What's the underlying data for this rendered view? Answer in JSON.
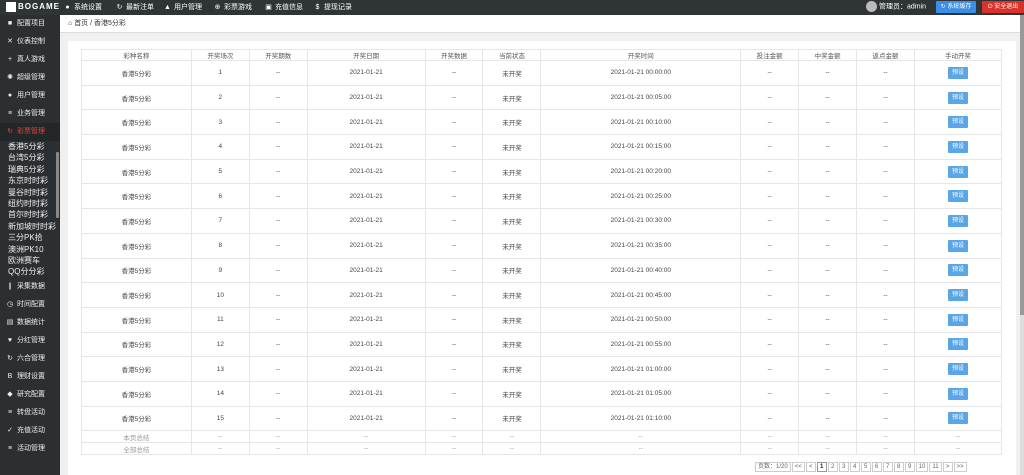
{
  "topbar": {
    "logo": "BOGAME",
    "menu": [
      {
        "label": "系统设置",
        "icon": "gear-icon",
        "glyph": "●"
      },
      {
        "label": "最新注单",
        "icon": "refresh-icon",
        "glyph": "↻"
      },
      {
        "label": "用户管理",
        "icon": "user-icon",
        "glyph": "▲"
      },
      {
        "label": "彩票游戏",
        "icon": "lottery-icon",
        "glyph": "⊕"
      },
      {
        "label": "充值信息",
        "icon": "card-icon",
        "glyph": "▣"
      },
      {
        "label": "提现记录",
        "icon": "dollar-icon",
        "glyph": "$"
      }
    ],
    "admin_label": "管理员：admin",
    "sysreg_label": "系统缓存",
    "logout_label": "安全退出"
  },
  "sidebar": {
    "items_top": [
      {
        "label": "配置项目",
        "icon": "config-icon",
        "glyph": "■"
      },
      {
        "label": "仪表控制",
        "icon": "shuffle-icon",
        "glyph": "✕"
      },
      {
        "label": "真人游戏",
        "icon": "plus-icon",
        "glyph": "+"
      },
      {
        "label": "超级管理",
        "icon": "gear-icon",
        "glyph": "✺"
      },
      {
        "label": "用户管理",
        "icon": "user-icon",
        "glyph": "●"
      },
      {
        "label": "业务管理",
        "icon": "list-icon",
        "glyph": "≡"
      },
      {
        "label": "彩票管理",
        "icon": "refresh-icon",
        "glyph": "↻"
      }
    ],
    "sub_items": [
      "香港5分彩",
      "台湾5分彩",
      "瑞典5分彩",
      "东京时时彩",
      "曼谷时时彩",
      "纽约时时彩",
      "首尔时时彩",
      "新加坡时时彩",
      "三分PK拾",
      "澳洲PK10",
      "欧洲赛车",
      "QQ分分彩"
    ],
    "items_bottom": [
      {
        "label": "采集数据",
        "icon": "bars-icon",
        "glyph": "∥"
      },
      {
        "label": "时间配置",
        "icon": "clock-icon",
        "glyph": "◷"
      },
      {
        "label": "数据统计",
        "icon": "chart-icon",
        "glyph": "▤"
      },
      {
        "label": "分红管理",
        "icon": "heart-icon",
        "glyph": "♥"
      },
      {
        "label": "六合管理",
        "icon": "refresh-icon",
        "glyph": "↻"
      },
      {
        "label": "理财设置",
        "icon": "bold-icon",
        "glyph": "B"
      },
      {
        "label": "研究配置",
        "icon": "gem-icon",
        "glyph": "◆"
      },
      {
        "label": "转盘活动",
        "icon": "list-icon",
        "glyph": "≡"
      },
      {
        "label": "充值活动",
        "icon": "check-icon",
        "glyph": "✓"
      },
      {
        "label": "活动管理",
        "icon": "list-icon",
        "glyph": "≡"
      }
    ]
  },
  "breadcrumb": {
    "home": "首页",
    "sep": " / ",
    "current": "香港5分彩"
  },
  "table": {
    "headers": [
      "彩种名称",
      "开奖场次",
      "开奖期数",
      "开奖日期",
      "开奖数据",
      "当前状态",
      "开奖时间",
      "投注金额",
      "中奖金额",
      "返点金额",
      "手动开奖"
    ],
    "rows": [
      [
        "香港5分彩",
        "1",
        "--",
        "2021-01-21",
        "--",
        "未开奖",
        "2021-01-21 00:00:00",
        "--",
        "--",
        "--"
      ],
      [
        "香港5分彩",
        "2",
        "--",
        "2021-01-21",
        "--",
        "未开奖",
        "2021-01-21 00:05:00",
        "--",
        "--",
        "--"
      ],
      [
        "香港5分彩",
        "3",
        "--",
        "2021-01-21",
        "--",
        "未开奖",
        "2021-01-21 00:10:00",
        "--",
        "--",
        "--"
      ],
      [
        "香港5分彩",
        "4",
        "--",
        "2021-01-21",
        "--",
        "未开奖",
        "2021-01-21 00:15:00",
        "--",
        "--",
        "--"
      ],
      [
        "香港5分彩",
        "5",
        "--",
        "2021-01-21",
        "--",
        "未开奖",
        "2021-01-21 00:20:00",
        "--",
        "--",
        "--"
      ],
      [
        "香港5分彩",
        "6",
        "--",
        "2021-01-21",
        "--",
        "未开奖",
        "2021-01-21 00:25:00",
        "--",
        "--",
        "--"
      ],
      [
        "香港5分彩",
        "7",
        "--",
        "2021-01-21",
        "--",
        "未开奖",
        "2021-01-21 00:30:00",
        "--",
        "--",
        "--"
      ],
      [
        "香港5分彩",
        "8",
        "--",
        "2021-01-21",
        "--",
        "未开奖",
        "2021-01-21 00:35:00",
        "--",
        "--",
        "--"
      ],
      [
        "香港5分彩",
        "9",
        "--",
        "2021-01-21",
        "--",
        "未开奖",
        "2021-01-21 00:40:00",
        "--",
        "--",
        "--"
      ],
      [
        "香港5分彩",
        "10",
        "--",
        "2021-01-21",
        "--",
        "未开奖",
        "2021-01-21 00:45:00",
        "--",
        "--",
        "--"
      ],
      [
        "香港5分彩",
        "11",
        "--",
        "2021-01-21",
        "--",
        "未开奖",
        "2021-01-21 00:50:00",
        "--",
        "--",
        "--"
      ],
      [
        "香港5分彩",
        "12",
        "--",
        "2021-01-21",
        "--",
        "未开奖",
        "2021-01-21 00:55:00",
        "--",
        "--",
        "--"
      ],
      [
        "香港5分彩",
        "13",
        "--",
        "2021-01-21",
        "--",
        "未开奖",
        "2021-01-21 01:00:00",
        "--",
        "--",
        "--"
      ],
      [
        "香港5分彩",
        "14",
        "--",
        "2021-01-21",
        "--",
        "未开奖",
        "2021-01-21 01:05:00",
        "--",
        "--",
        "--"
      ],
      [
        "香港5分彩",
        "15",
        "--",
        "2021-01-21",
        "--",
        "未开奖",
        "2021-01-21 01:10:00",
        "--",
        "--",
        "--"
      ]
    ],
    "action_label": "预设",
    "summary_rows": [
      {
        "label": "本页总结",
        "dash": "--"
      },
      {
        "label": "全部总结",
        "dash": "--"
      }
    ]
  },
  "pager": {
    "info": "页数：1/20",
    "first": "<<",
    "prev": "<",
    "pages": [
      "1",
      "2",
      "3",
      "4",
      "5",
      "6",
      "7",
      "8",
      "9",
      "10",
      "11"
    ],
    "current": "1",
    "next": ">",
    "last": ">>"
  },
  "colors": {
    "accent": "#3a8ee6",
    "danger": "#d9322a",
    "sidebar_bg": "#2b2f32",
    "topbar_bg": "#2f3437"
  }
}
